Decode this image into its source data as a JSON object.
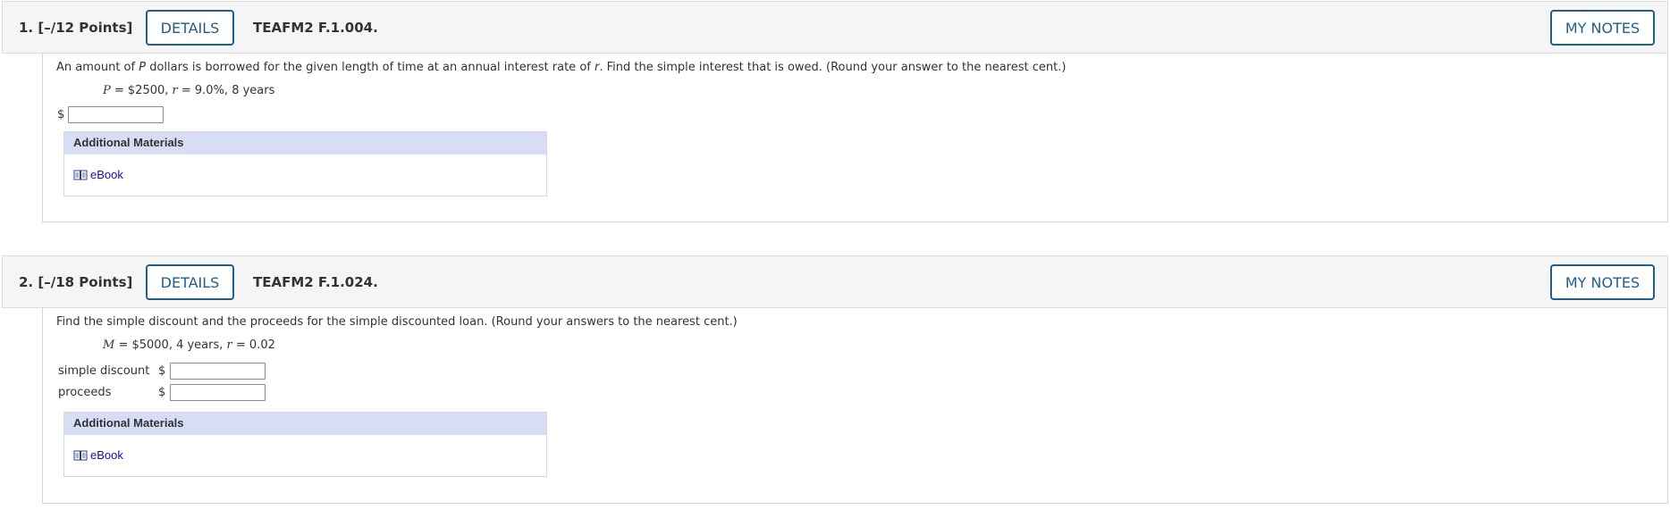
{
  "questions": [
    {
      "number_points": "1.  [–/12 Points]",
      "details_label": "DETAILS",
      "code": "TEAFM2 F.1.004.",
      "notes_label": "MY NOTES",
      "prompt": {
        "part1": "An amount of ",
        "var1": "P",
        "part2": " dollars is borrowed for the given length of time at an annual interest rate of ",
        "var2": "r",
        "part3": ". Find the simple interest that is owed. (Round your answer to the nearest cent.)"
      },
      "given": {
        "v1": "P",
        "t1": " = $2500, ",
        "v2": "r",
        "t2": " = 9.0%, 8 years"
      },
      "currency": "$",
      "answer_value": "",
      "materials_title": "Additional Materials",
      "ebook_label": "eBook"
    },
    {
      "number_points": "2.  [–/18 Points]",
      "details_label": "DETAILS",
      "code": "TEAFM2 F.1.024.",
      "notes_label": "MY NOTES",
      "prompt_text": "Find the simple discount and the proceeds for the simple discounted loan. (Round your answers to the nearest cent.)",
      "given": {
        "v1": "M",
        "t1": " = $5000, 4 years, ",
        "v2": "r",
        "t2": " = 0.02"
      },
      "rows": [
        {
          "label": "simple discount",
          "currency": "$",
          "value": ""
        },
        {
          "label": "proceeds",
          "currency": "$",
          "value": ""
        }
      ],
      "materials_title": "Additional Materials",
      "ebook_label": "eBook"
    }
  ]
}
